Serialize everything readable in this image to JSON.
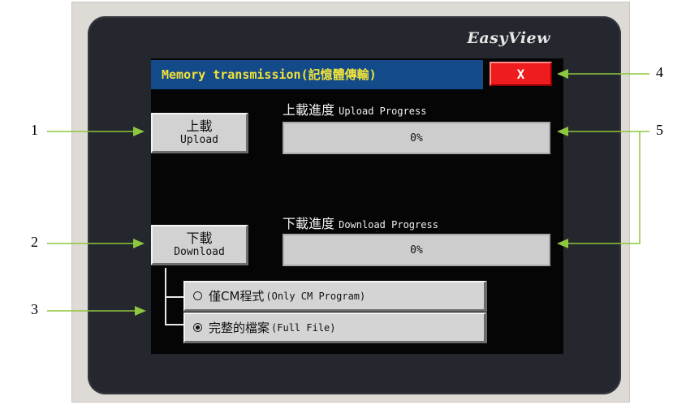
{
  "device": {
    "brand": "EasyView"
  },
  "dialog": {
    "title": "Memory transmission(記憶體傳輸)",
    "close_label": "X"
  },
  "upload": {
    "button_zh": "上載",
    "button_en": "Upload",
    "progress_label_zh": "上載進度",
    "progress_label_en": "Upload Progress",
    "progress_text": "0%",
    "progress_fraction": 0
  },
  "download": {
    "button_zh": "下載",
    "button_en": "Download",
    "progress_label_zh": "下載進度",
    "progress_label_en": "Download Progress",
    "progress_text": "0%",
    "progress_fraction": 0
  },
  "options": [
    {
      "label_zh": "僅CM程式",
      "label_en": "(Only CM Program)",
      "selected": false
    },
    {
      "label_zh": "完整的檔案",
      "label_en": "(Full File)",
      "selected": true
    }
  ],
  "callouts": [
    "1",
    "2",
    "3",
    "4",
    "5"
  ],
  "colors": {
    "title_bar": "#134a8a",
    "title_text": "#f2e33a",
    "close_button": "#ee1c1c",
    "arrow": "#8dc63f"
  }
}
